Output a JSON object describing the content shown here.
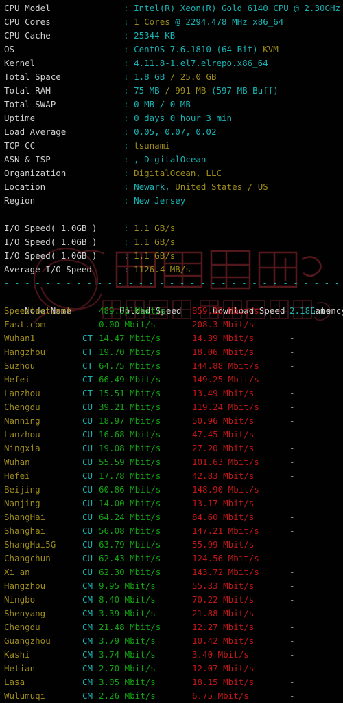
{
  "theme": {
    "background": "#010101",
    "label_color": "#d0d0d0",
    "cyan": "#19b2b2",
    "yellow": "#9d8b1b",
    "green": "#13a313",
    "red": "#c41616",
    "separator_color": "#19b2b2"
  },
  "system_info": {
    "separator": "- - - - - - - - - - - - - - - - - - - - - - - - - - - - - - - - - - - - - - - - - - - - - - - - -",
    "rows": [
      {
        "label": "CPU Model",
        "colon": ":",
        "parts": [
          {
            "text": "Intel(R) Xeon(R) Gold 6140 CPU @ 2.30GHz",
            "color": "cyan"
          }
        ]
      },
      {
        "label": "CPU Cores",
        "colon": ":",
        "parts": [
          {
            "text": "1 Cores ",
            "color": "yellow"
          },
          {
            "text": "@ 2294.478 MHz x86_64",
            "color": "cyan"
          }
        ]
      },
      {
        "label": "CPU Cache",
        "colon": ":",
        "parts": [
          {
            "text": "25344 KB",
            "color": "cyan"
          }
        ]
      },
      {
        "label": "OS",
        "colon": ":",
        "parts": [
          {
            "text": "CentOS 7.6.1810 (64 Bit) ",
            "color": "cyan"
          },
          {
            "text": "KVM",
            "color": "yellow"
          }
        ]
      },
      {
        "label": "Kernel",
        "colon": ":",
        "parts": [
          {
            "text": "4.11.8-1.el7.elrepo.x86_64",
            "color": "cyan"
          }
        ]
      },
      {
        "label": "Total Space",
        "colon": ":",
        "parts": [
          {
            "text": "1.8 GB ",
            "color": "cyan"
          },
          {
            "text": "/ 25.0 GB",
            "color": "yellow"
          }
        ]
      },
      {
        "label": "Total RAM",
        "colon": ":",
        "parts": [
          {
            "text": "75 MB ",
            "color": "cyan"
          },
          {
            "text": "/ 991 MB ",
            "color": "yellow"
          },
          {
            "text": "(597 MB Buff)",
            "color": "cyan"
          }
        ]
      },
      {
        "label": "Total SWAP",
        "colon": ":",
        "parts": [
          {
            "text": "0 MB / 0 MB",
            "color": "cyan"
          }
        ]
      },
      {
        "label": "Uptime",
        "colon": ":",
        "parts": [
          {
            "text": "0 days 0 hour 3 min",
            "color": "cyan"
          }
        ]
      },
      {
        "label": "Load Average",
        "colon": ":",
        "parts": [
          {
            "text": "0.05, 0.07, 0.02",
            "color": "cyan"
          }
        ]
      },
      {
        "label": "TCP CC",
        "colon": ":",
        "parts": [
          {
            "text": "tsunami",
            "color": "yellow"
          }
        ]
      },
      {
        "label": "ASN & ISP",
        "colon": ":",
        "parts": [
          {
            "text": ", DigitalOcean",
            "color": "cyan"
          }
        ]
      },
      {
        "label": "Organization",
        "colon": ":",
        "parts": [
          {
            "text": "DigitalOcean, LLC",
            "color": "yellow"
          }
        ]
      },
      {
        "label": "Location",
        "colon": ":",
        "parts": [
          {
            "text": "Newark, ",
            "color": "cyan"
          },
          {
            "text": "United States / US",
            "color": "yellow"
          }
        ]
      },
      {
        "label": "Region",
        "colon": ":",
        "parts": [
          {
            "text": "New Jersey",
            "color": "cyan"
          }
        ]
      }
    ]
  },
  "io_test": {
    "rows": [
      {
        "label": "I/O Speed( 1.0GB )",
        "colon": ":",
        "value": "1.1 GB/s",
        "color": "yellow"
      },
      {
        "label": "I/O Speed( 1.0GB )",
        "colon": ":",
        "value": "1.1 GB/s",
        "color": "yellow"
      },
      {
        "label": "I/O Speed( 1.0GB )",
        "colon": ":",
        "value": "1.1 GB/s",
        "color": "yellow"
      },
      {
        "label": "Average I/O Speed",
        "colon": ":",
        "value": "1126.4 MB/s",
        "color": "yellow"
      }
    ]
  },
  "speedtest": {
    "headers": {
      "node": "Node Name",
      "upload": "Upload Speed",
      "download": "Download Speed",
      "latency": "Latency"
    },
    "rows": [
      {
        "node": "Speedtest.net",
        "isp": "",
        "upload": "489.31 Mbit/s",
        "download": "859.23 Mbit/s",
        "latency": "2.186",
        "latency_unit": "ms"
      },
      {
        "node": "Fast.com",
        "isp": "",
        "upload": "0.00 Mbit/s",
        "download": "208.3 Mbit/s",
        "latency": "-",
        "latency_unit": ""
      },
      {
        "node": "Wuhan1",
        "isp": "CT",
        "upload": "14.47 Mbit/s",
        "download": "14.39 Mbit/s",
        "latency": "-",
        "latency_unit": ""
      },
      {
        "node": "Hangzhou",
        "isp": "CT",
        "upload": "19.70 Mbit/s",
        "download": "18.06 Mbit/s",
        "latency": "-",
        "latency_unit": ""
      },
      {
        "node": "Suzhou",
        "isp": "CT",
        "upload": "64.75 Mbit/s",
        "download": "144.88 Mbit/s",
        "latency": "-",
        "latency_unit": ""
      },
      {
        "node": "Hefei",
        "isp": "CT",
        "upload": "66.49 Mbit/s",
        "download": "149.25 Mbit/s",
        "latency": "-",
        "latency_unit": ""
      },
      {
        "node": "Lanzhou",
        "isp": "CT",
        "upload": "15.51 Mbit/s",
        "download": "13.49 Mbit/s",
        "latency": "-",
        "latency_unit": ""
      },
      {
        "node": "Chengdu",
        "isp": "CU",
        "upload": "39.21 Mbit/s",
        "download": "119.24 Mbit/s",
        "latency": "-",
        "latency_unit": ""
      },
      {
        "node": "Nanning",
        "isp": "CU",
        "upload": "18.97 Mbit/s",
        "download": "50.96 Mbit/s",
        "latency": "-",
        "latency_unit": ""
      },
      {
        "node": "Lanzhou",
        "isp": "CU",
        "upload": "16.68 Mbit/s",
        "download": "47.45 Mbit/s",
        "latency": "-",
        "latency_unit": ""
      },
      {
        "node": "Ningxia",
        "isp": "CU",
        "upload": "19.08 Mbit/s",
        "download": "27.20 Mbit/s",
        "latency": "-",
        "latency_unit": ""
      },
      {
        "node": "Wuhan",
        "isp": "CU",
        "upload": "55.59 Mbit/s",
        "download": "101.63 Mbit/s",
        "latency": "-",
        "latency_unit": ""
      },
      {
        "node": "Hefei",
        "isp": "CU",
        "upload": "17.78 Mbit/s",
        "download": "42.83 Mbit/s",
        "latency": "-",
        "latency_unit": ""
      },
      {
        "node": "Beijing",
        "isp": "CU",
        "upload": "60.86 Mbit/s",
        "download": "148.90 Mbit/s",
        "latency": "-",
        "latency_unit": ""
      },
      {
        "node": "Nanjing",
        "isp": "CU",
        "upload": "14.00 Mbit/s",
        "download": "13.17 Mbit/s",
        "latency": "-",
        "latency_unit": ""
      },
      {
        "node": "ShangHai",
        "isp": "CU",
        "upload": "64.24 Mbit/s",
        "download": "84.60 Mbit/s",
        "latency": "-",
        "latency_unit": ""
      },
      {
        "node": "Shanghai",
        "isp": "CU",
        "upload": "56.08 Mbit/s",
        "download": "147.21 Mbit/s",
        "latency": "-",
        "latency_unit": ""
      },
      {
        "node": "ShangHai5G",
        "isp": "CU",
        "upload": "63.79 Mbit/s",
        "download": "55.99 Mbit/s",
        "latency": "-",
        "latency_unit": ""
      },
      {
        "node": "Changchun",
        "isp": "CU",
        "upload": "62.43 Mbit/s",
        "download": "124.56 Mbit/s",
        "latency": "-",
        "latency_unit": ""
      },
      {
        "node": "Xi an",
        "isp": "CU",
        "upload": "62.30 Mbit/s",
        "download": "143.72 Mbit/s",
        "latency": "-",
        "latency_unit": ""
      },
      {
        "node": "Hangzhou",
        "isp": "CM",
        "upload": "9.95 Mbit/s",
        "download": "55.33 Mbit/s",
        "latency": "-",
        "latency_unit": ""
      },
      {
        "node": "Ningbo",
        "isp": "CM",
        "upload": "8.40 Mbit/s",
        "download": "70.22 Mbit/s",
        "latency": "-",
        "latency_unit": ""
      },
      {
        "node": "Shenyang",
        "isp": "CM",
        "upload": "3.39 Mbit/s",
        "download": "21.88 Mbit/s",
        "latency": "-",
        "latency_unit": ""
      },
      {
        "node": "Chengdu",
        "isp": "CM",
        "upload": "21.48 Mbit/s",
        "download": "12.27 Mbit/s",
        "latency": "-",
        "latency_unit": ""
      },
      {
        "node": "Guangzhou",
        "isp": "CM",
        "upload": "3.79 Mbit/s",
        "download": "10.42 Mbit/s",
        "latency": "-",
        "latency_unit": ""
      },
      {
        "node": "Kashi",
        "isp": "CM",
        "upload": "3.74 Mbit/s",
        "download": "3.40 Mbit/s",
        "latency": "-",
        "latency_unit": ""
      },
      {
        "node": "Hetian",
        "isp": "CM",
        "upload": "2.70 Mbit/s",
        "download": "12.07 Mbit/s",
        "latency": "-",
        "latency_unit": ""
      },
      {
        "node": "Lasa",
        "isp": "CM",
        "upload": "3.05 Mbit/s",
        "download": "18.15 Mbit/s",
        "latency": "-",
        "latency_unit": ""
      },
      {
        "node": "Wulumuqi",
        "isp": "CM",
        "upload": "2.26 Mbit/s",
        "download": "6.75 Mbit/s",
        "latency": "-",
        "latency_unit": ""
      }
    ]
  },
  "watermark": {
    "text_primary": "超算网络",
    "text_secondary": "为跨境电商 助力外贸企业出海",
    "color": "#3a0f0f"
  }
}
